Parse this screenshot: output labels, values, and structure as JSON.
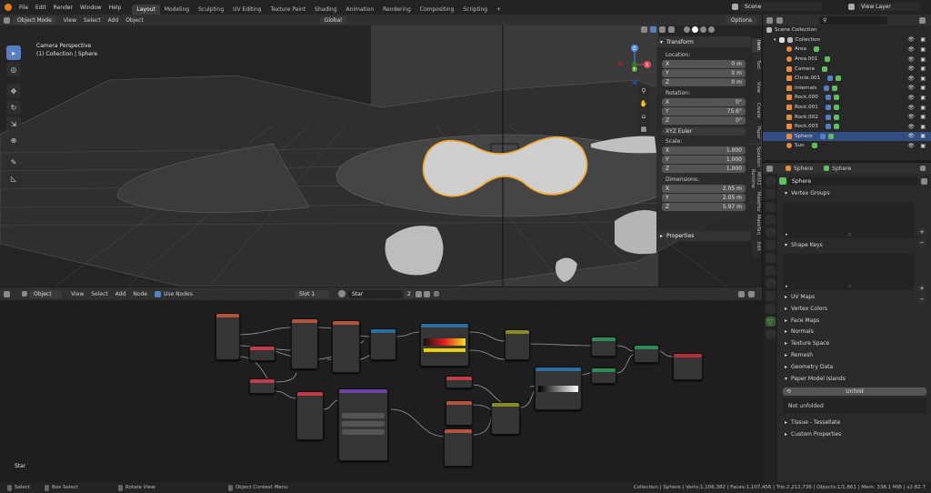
{
  "topbar": {
    "menus": [
      "File",
      "Edit",
      "Render",
      "Window",
      "Help"
    ],
    "workspaces": [
      "Layout",
      "Modeling",
      "Sculpting",
      "UV Editing",
      "Texture Paint",
      "Shading",
      "Animation",
      "Rendering",
      "Compositing",
      "Scripting"
    ],
    "active_workspace": "Layout",
    "add_tab": "+",
    "scene_label": "Scene",
    "view_layer_label": "View Layer"
  },
  "viewport_header": {
    "mode": "Object Mode",
    "menus": [
      "View",
      "Select",
      "Add",
      "Object"
    ],
    "transform_orientation": "Global",
    "options_label": "Options"
  },
  "viewport": {
    "view_name": "Camera Perspective",
    "collection_text": "(1) Collection | Sphere",
    "gizmo_axes": [
      "X",
      "Y",
      "Z"
    ]
  },
  "npanel": {
    "title": "Transform",
    "location_label": "Location:",
    "location": [
      {
        "axis": "X",
        "value": "0 m"
      },
      {
        "axis": "Y",
        "value": "0 m"
      },
      {
        "axis": "Z",
        "value": "0 m"
      }
    ],
    "rotation_label": "Rotation:",
    "rotation": [
      {
        "axis": "X",
        "value": "0°"
      },
      {
        "axis": "Y",
        "value": "75.6°"
      },
      {
        "axis": "Z",
        "value": "0°"
      }
    ],
    "rotation_mode": "XYZ Euler",
    "scale_label": "Scale:",
    "scale": [
      {
        "axis": "X",
        "value": "1.000"
      },
      {
        "axis": "Y",
        "value": "1.000"
      },
      {
        "axis": "Z",
        "value": "1.000"
      }
    ],
    "dimensions_label": "Dimensions:",
    "dimensions": [
      {
        "axis": "X",
        "value": "2.05 m"
      },
      {
        "axis": "Y",
        "value": "2.05 m"
      },
      {
        "axis": "Z",
        "value": "5.97 m"
      }
    ],
    "properties_label": "Properties",
    "side_tabs": [
      "Item",
      "Tool",
      "View",
      "Create",
      "Paper",
      "Speakers",
      "MHX2 Runtime",
      "MakeHuman",
      "MakeTarget",
      "Edit"
    ]
  },
  "node_editor": {
    "object_type": "Object",
    "menus": [
      "View",
      "Select",
      "Add",
      "Node"
    ],
    "use_nodes_label": "Use Nodes",
    "slot": "Slot 1",
    "material_name": "Star",
    "user_count": "2",
    "footer_material": "Star"
  },
  "outliner": {
    "root": "Scene Collection",
    "collection": "Collection",
    "items": [
      {
        "name": "Area",
        "selected": false
      },
      {
        "name": "Area.001",
        "selected": false
      },
      {
        "name": "Camera",
        "selected": false
      },
      {
        "name": "Circle.001",
        "selected": false
      },
      {
        "name": "Internals",
        "selected": false
      },
      {
        "name": "Rock.000",
        "selected": false
      },
      {
        "name": "Rock.001",
        "selected": false
      },
      {
        "name": "Rock.002",
        "selected": false
      },
      {
        "name": "Rock.003",
        "selected": false
      },
      {
        "name": "Sphere",
        "selected": true
      },
      {
        "name": "Sun",
        "selected": false
      }
    ]
  },
  "properties": {
    "object_name": "Sphere",
    "data_name": "Sphere",
    "mesh_name": "Sphere",
    "vertex_groups": "Vertex Groups",
    "shape_keys": "Shape Keys",
    "sections": [
      "UV Maps",
      "Vertex Colors",
      "Face Maps",
      "Normals",
      "Texture Space",
      "Remesh",
      "Geometry Data",
      "Paper Model Islands"
    ],
    "unfold_button": "Unfold",
    "not_unfolded": "Not unfolded",
    "tissue": "Tissue - Tessellate",
    "custom_props": "Custom Properties"
  },
  "statusbar": {
    "select": "Select",
    "box_select": "Box Select",
    "rotate_view": "Rotate View",
    "context_menu": "Object Context Menu",
    "stats": "Collection | Sphere | Verts:1,106,382 | Faces:1,107,456 | Tris:2,212,736 | Objects:1/1,861 | Mem: 338.1 MiB | v2.82.7"
  },
  "colors": {
    "accent": "#5680c2",
    "selection": "#f5a623",
    "background": "#1d1d1d"
  }
}
